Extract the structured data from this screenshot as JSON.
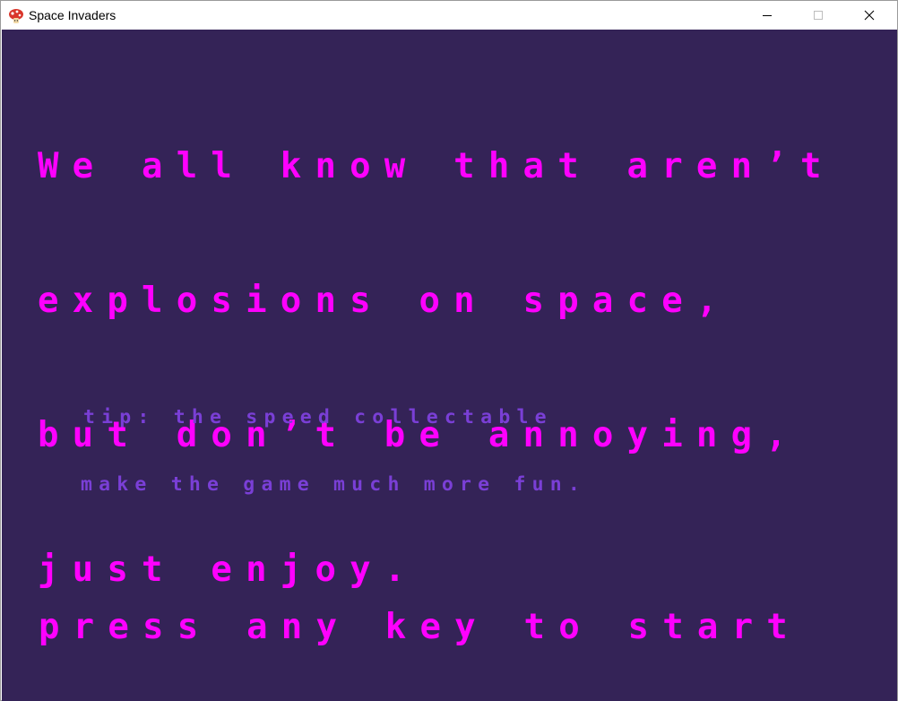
{
  "window": {
    "title": "Space Invaders",
    "app_icon": "mushroom-icon",
    "controls": {
      "minimize_icon": "minimize-icon",
      "maximize_icon": "maximize-icon",
      "close_icon": "close-icon"
    }
  },
  "game": {
    "background_color": "#342357",
    "intro_message": {
      "color": "#ff00ff",
      "lines": [
        "We all know that aren’t",
        "explosions on space,",
        "but don’t be annoying,",
        "just enjoy."
      ]
    },
    "tip": {
      "color": "#7a3fd6",
      "lines": [
        "tip: the speed collectable",
        "make the game much more fun."
      ]
    },
    "start_prompt": {
      "color": "#ff00ff",
      "text": "press any key to start"
    }
  }
}
